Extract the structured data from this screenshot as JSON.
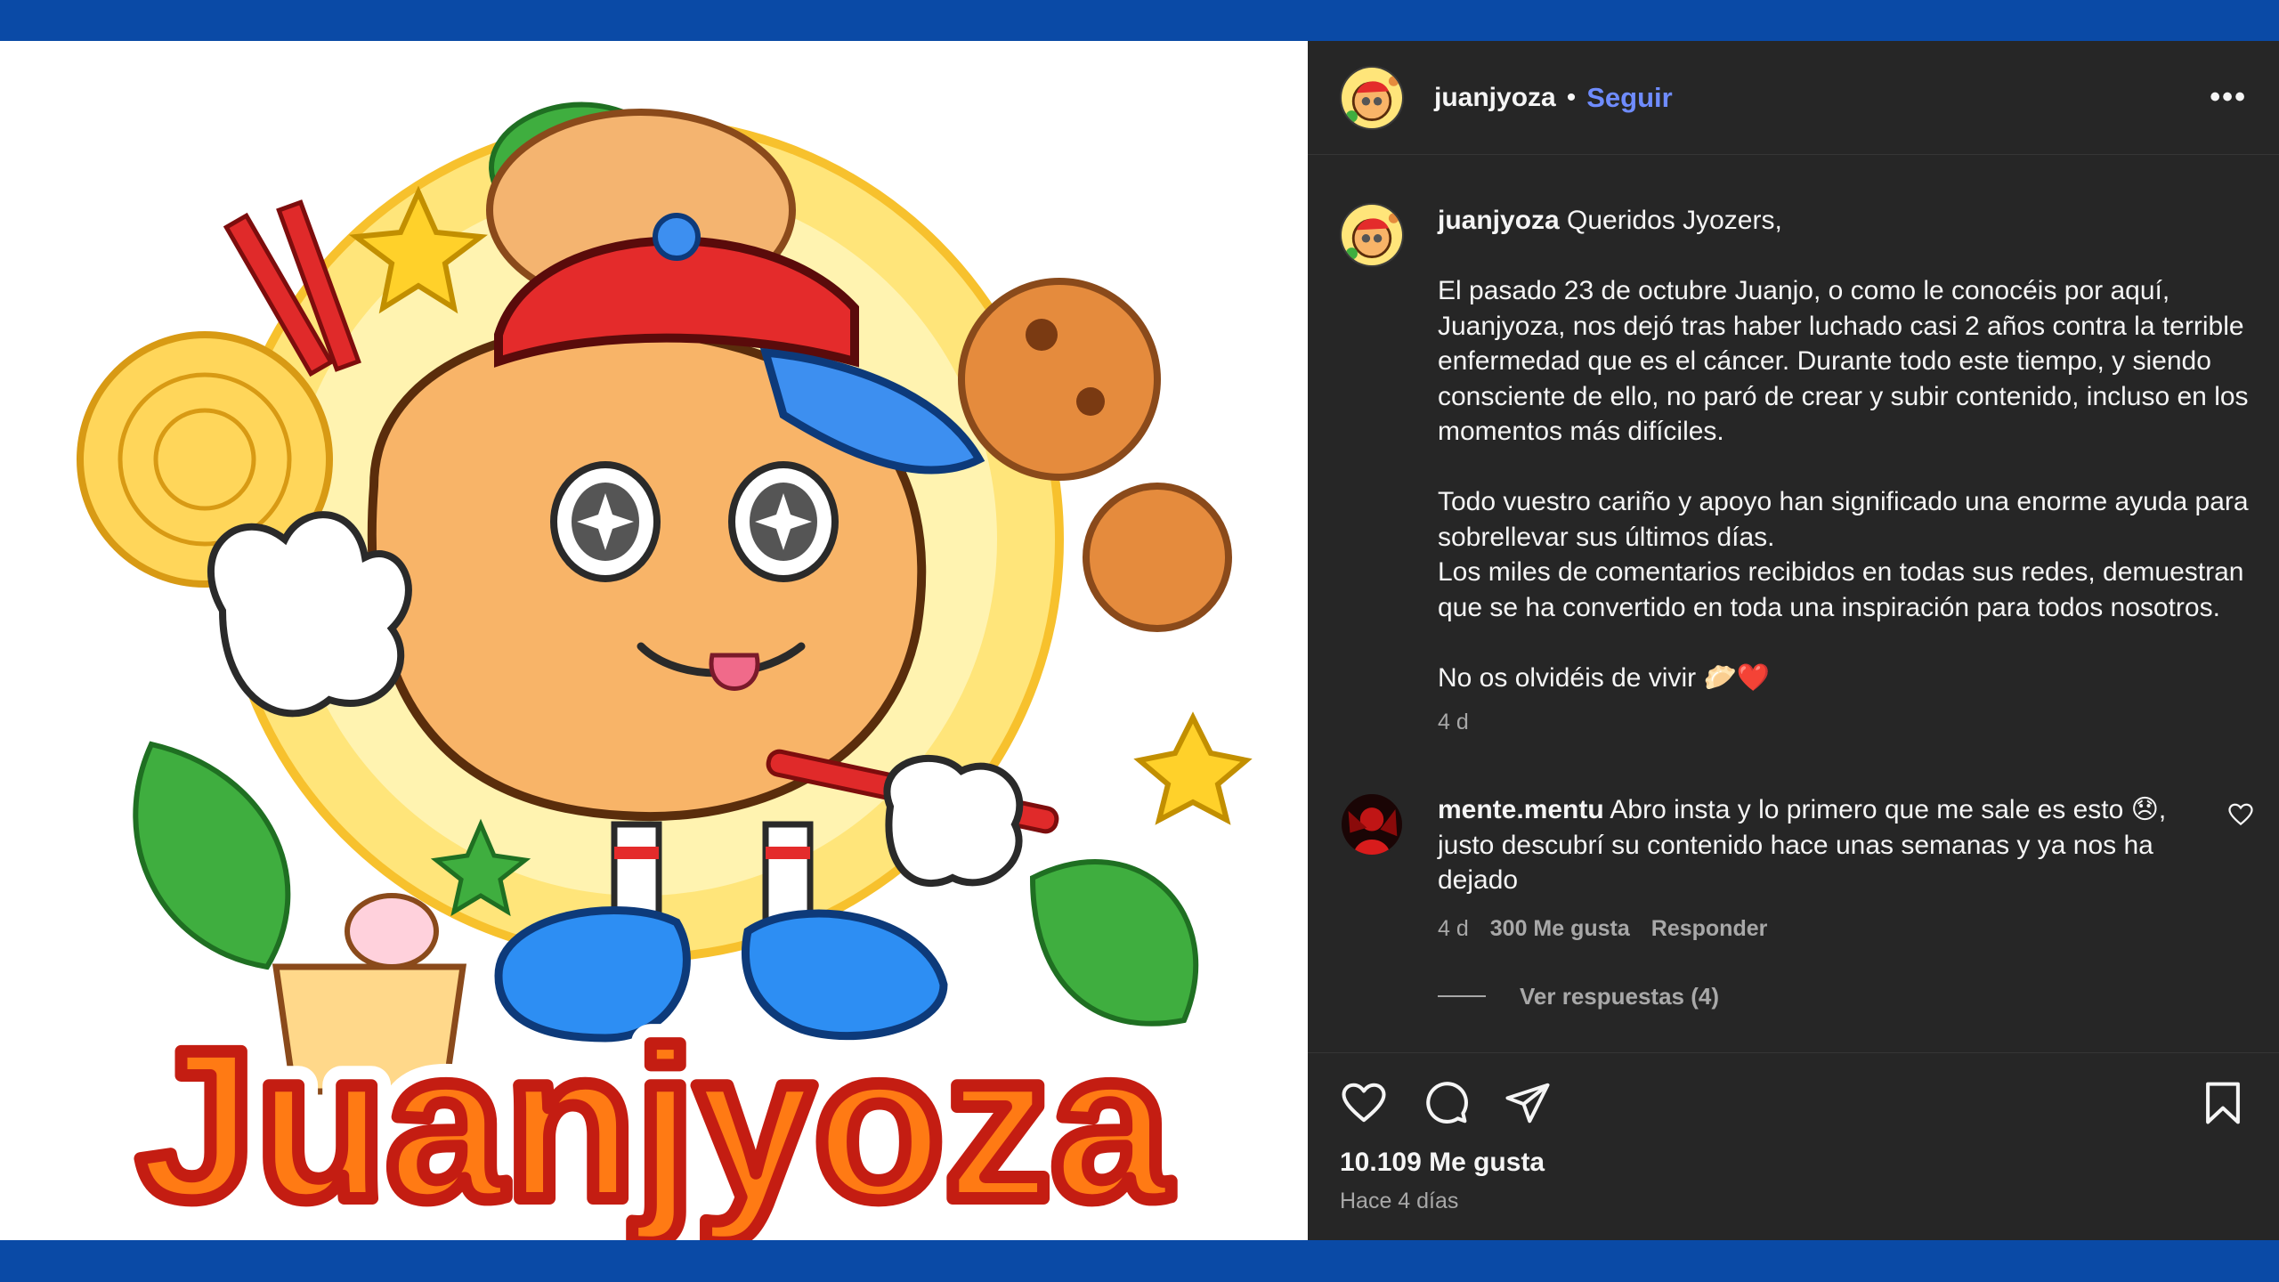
{
  "post": {
    "image_logo_text": "Juanjyoza"
  },
  "header": {
    "username": "juanjyoza",
    "separator": "•",
    "follow_label": "Seguir",
    "more_label": "•••"
  },
  "caption": {
    "username": "juanjyoza",
    "text": " Queridos Jyozers,\n\nEl pasado 23 de octubre Juanjo, o como le conocéis por aquí, Juanjyoza, nos dejó tras haber luchado casi 2 años contra la terrible enfermedad que es el cáncer. Durante todo este tiempo, y siendo consciente de ello, no paró de crear y subir contenido, incluso en los momentos más difíciles.\n\nTodo vuestro cariño y apoyo han significado una enorme ayuda para sobrellevar sus últimos días.\nLos miles de comentarios recibidos en todas sus redes, demuestran que se ha convertido en toda una inspiración para todos nosotros.\n\nNo os olvidéis de vivir ",
    "emojis": "🥟❤️",
    "age": "4 d"
  },
  "comment": {
    "username": "mente.mentu",
    "text": " Abro insta y lo primero que me sale es esto 😞, justo descubrí su contenido hace unas semanas y ya nos ha dejado",
    "age": "4 d",
    "likes": "300 Me gusta",
    "reply_label": "Responder",
    "view_replies": "Ver respuestas (4)"
  },
  "footer": {
    "likes": "10.109 Me gusta",
    "time": "Hace 4 días"
  },
  "colors": {
    "background": "#0a4aa6",
    "panel": "#262626",
    "follow": "#6f8cff",
    "muted": "#a8a8a8"
  }
}
